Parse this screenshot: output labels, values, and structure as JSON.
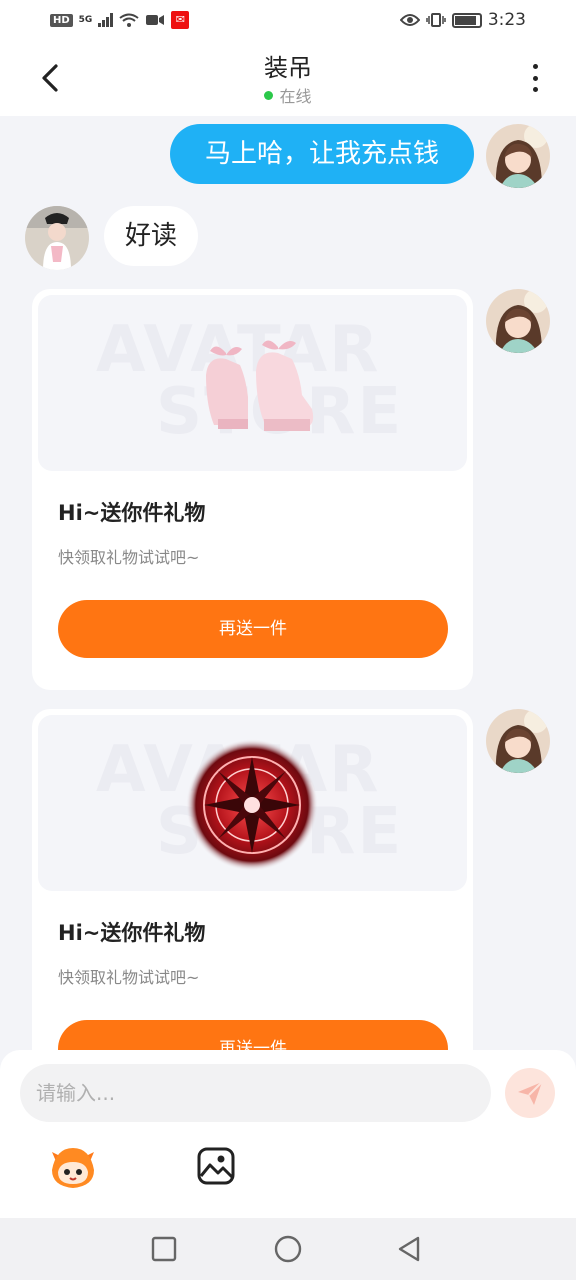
{
  "status_bar": {
    "network_badge": "HD",
    "network_type": "5G",
    "time": "3:23"
  },
  "header": {
    "title": "装吊",
    "status": "在线"
  },
  "messages": {
    "me_text": "马上哈，让我充点钱",
    "other_text": "好读"
  },
  "gift_cards": [
    {
      "watermark_line1": "AVATAR",
      "watermark_line2": "STORE",
      "item": "pink-platform-shoes",
      "title": "Hi~送你件礼物",
      "subtitle": "快领取礼物试试吧~",
      "button_label": "再送一件"
    },
    {
      "watermark_line1": "AVATAR",
      "watermark_line2": "STORE",
      "item": "red-magic-circle",
      "title": "Hi~送你件礼物",
      "subtitle": "快领取礼物试试吧~",
      "button_label": "再送一件"
    }
  ],
  "input": {
    "placeholder": "请输入..."
  },
  "colors": {
    "my_bubble": "#1fb1f5",
    "accent_button": "#ff7512",
    "online_dot": "#2bc84a"
  }
}
